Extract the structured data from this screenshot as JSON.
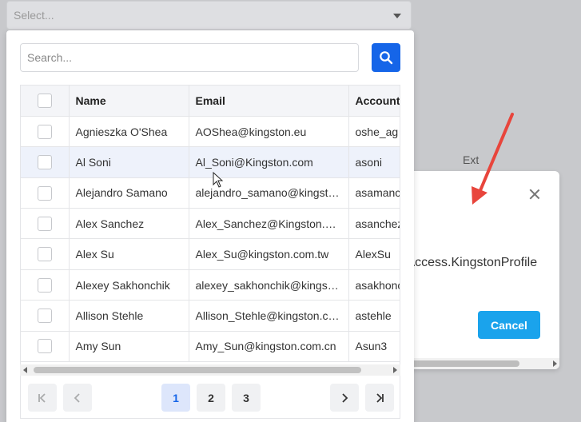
{
  "select": {
    "placeholder": "Select..."
  },
  "search": {
    "placeholder": "Search..."
  },
  "table": {
    "columns": [
      "Name",
      "Email",
      "Account"
    ],
    "rows": [
      {
        "name": "Agnieszka O'Shea",
        "email": "AOShea@kingston.eu",
        "account": "oshe_ag"
      },
      {
        "name": "Al Soni",
        "email": "Al_Soni@Kingston.com",
        "account": "asoni"
      },
      {
        "name": "Alejandro Samano",
        "email": "alejandro_samano@kingst…",
        "account": "asamanc"
      },
      {
        "name": "Alex Sanchez",
        "email": "Alex_Sanchez@Kingston.…",
        "account": "asanchez"
      },
      {
        "name": "Alex Su",
        "email": "Alex_Su@kingston.com.tw",
        "account": "AlexSu"
      },
      {
        "name": "Alexey Sakhonchik",
        "email": "alexey_sakhonchik@kings…",
        "account": "asakhonc"
      },
      {
        "name": "Allison Stehle",
        "email": "Allison_Stehle@kingston.c…",
        "account": "astehle"
      },
      {
        "name": "Amy Sun",
        "email": "Amy_Sun@kingston.com.cn",
        "account": "Asun3"
      }
    ]
  },
  "pagination": {
    "pages": [
      "1",
      "2",
      "3"
    ],
    "current": "1"
  },
  "background": {
    "ext_label": "Ext",
    "modal_text": "iceAccess.KingstonProfile",
    "cancel_label": "Cancel"
  },
  "colors": {
    "primary": "#1565e8",
    "cancel": "#1aa3ec",
    "annotation_arrow": "#e8453c"
  }
}
